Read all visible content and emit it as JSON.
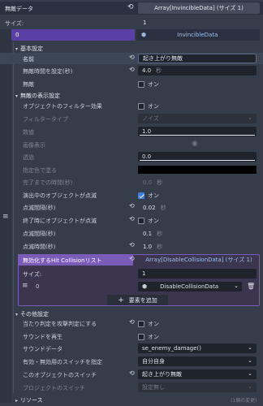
{
  "header": {
    "title": "無敵データ",
    "type_label": "Array[InvincibleData] (サイズ 1)"
  },
  "size_row": {
    "label": "サイズ:",
    "value": "1"
  },
  "element": {
    "index": "0",
    "type_label": "InvincibleData"
  },
  "basic": {
    "title": "基本設定",
    "name_label": "名前",
    "name_value": "起き上がり無敵",
    "duration_label": "無敵時間を設定(秒)",
    "duration_value": "4.0",
    "duration_unit": "秒",
    "invincible_label": "無敵",
    "invincible_value": "オン"
  },
  "display": {
    "title": "無敵の表示設定",
    "filter_effect_label": "オブジェクトのフィルター効果",
    "filter_effect_value": "オン",
    "filter_type_label": "フィルタータイプ",
    "filter_type_value": "ノイズ",
    "amount_label": "数値",
    "amount_value": "1.0",
    "image_label": "画像表示",
    "alpha_label": "透過",
    "alpha_value": "0.0",
    "color_label": "指定色で塗る",
    "finish_time_label": "完了までの時間(秒)",
    "finish_time_value": "0.0",
    "finish_time_unit": "秒",
    "blink_label": "演出中のオブジェクトが点滅",
    "blink_value": "オン",
    "blink_interval_label": "点滅間隔(秒)",
    "blink_interval_value": "0.02",
    "blink_interval_unit": "秒",
    "end_blink_label": "終了時にオブジェクトが点滅",
    "end_blink_value": "オン",
    "end_blink_interval_label": "点滅間隔(秒)",
    "end_blink_interval_value": "0.1",
    "end_blink_interval_unit": "秒",
    "end_blink_time_label": "点滅時間(秒)",
    "end_blink_time_value": "1.0",
    "end_blink_time_unit": "秒"
  },
  "hit_list": {
    "title": "無効化するHit Collisionリスト",
    "type_label": "Array[DisableCollisionData] (サイズ 1)",
    "size_label": "サイズ:",
    "size_value": "1",
    "item_index": "0",
    "item_type": "DisableCollisionData",
    "add_label": "要素を追加"
  },
  "other": {
    "title": "その他設定",
    "attack_label": "当たり判定を攻撃判定にする",
    "attack_value": "オン",
    "sound_play_label": "サウンドを再生",
    "sound_play_value": "オン",
    "sound_data_label": "サウンドデータ",
    "sound_data_value": "se_enemy_damage()",
    "switch_target_label": "有効・無効用のスイッチを指定",
    "switch_target_value": "自分自身",
    "object_switch_label": "このオブジェクトのスイッチ",
    "object_switch_value": "起き上がり無敵",
    "project_switch_label": "プロジェクトのスイッチ",
    "project_switch_value": "設定無し"
  },
  "resource": {
    "title": "リソース",
    "count": "(1個の変更)"
  },
  "colors": {
    "accent_purple": "#7b5bb8",
    "accent_blue": "#5a3fa6",
    "checkbox_on": "#3d7fe0"
  }
}
